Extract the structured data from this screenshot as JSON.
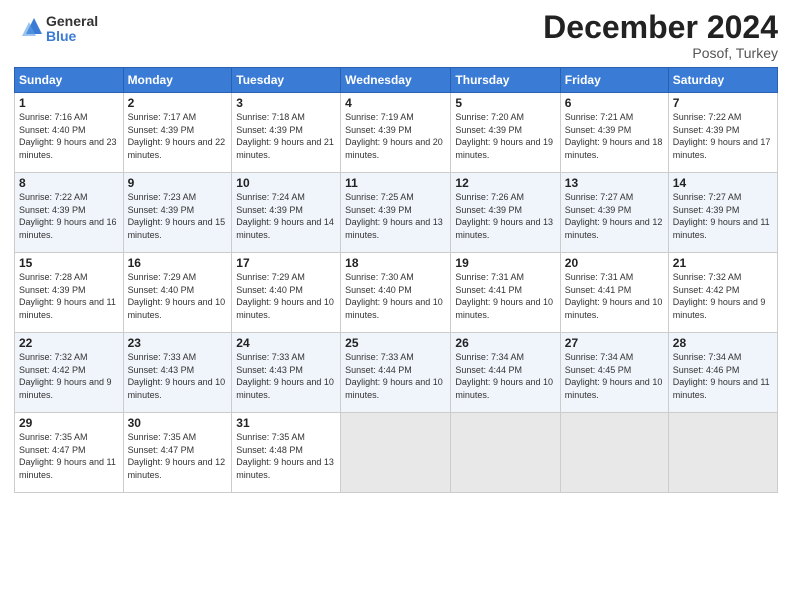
{
  "logo": {
    "general": "General",
    "blue": "Blue"
  },
  "header": {
    "title": "December 2024",
    "subtitle": "Posof, Turkey"
  },
  "columns": [
    "Sunday",
    "Monday",
    "Tuesday",
    "Wednesday",
    "Thursday",
    "Friday",
    "Saturday"
  ],
  "weeks": [
    [
      {
        "day": "1",
        "sunrise": "7:16 AM",
        "sunset": "4:40 PM",
        "daylight": "9 hours and 23 minutes."
      },
      {
        "day": "2",
        "sunrise": "7:17 AM",
        "sunset": "4:39 PM",
        "daylight": "9 hours and 22 minutes."
      },
      {
        "day": "3",
        "sunrise": "7:18 AM",
        "sunset": "4:39 PM",
        "daylight": "9 hours and 21 minutes."
      },
      {
        "day": "4",
        "sunrise": "7:19 AM",
        "sunset": "4:39 PM",
        "daylight": "9 hours and 20 minutes."
      },
      {
        "day": "5",
        "sunrise": "7:20 AM",
        "sunset": "4:39 PM",
        "daylight": "9 hours and 19 minutes."
      },
      {
        "day": "6",
        "sunrise": "7:21 AM",
        "sunset": "4:39 PM",
        "daylight": "9 hours and 18 minutes."
      },
      {
        "day": "7",
        "sunrise": "7:22 AM",
        "sunset": "4:39 PM",
        "daylight": "9 hours and 17 minutes."
      }
    ],
    [
      {
        "day": "8",
        "sunrise": "7:22 AM",
        "sunset": "4:39 PM",
        "daylight": "9 hours and 16 minutes."
      },
      {
        "day": "9",
        "sunrise": "7:23 AM",
        "sunset": "4:39 PM",
        "daylight": "9 hours and 15 minutes."
      },
      {
        "day": "10",
        "sunrise": "7:24 AM",
        "sunset": "4:39 PM",
        "daylight": "9 hours and 14 minutes."
      },
      {
        "day": "11",
        "sunrise": "7:25 AM",
        "sunset": "4:39 PM",
        "daylight": "9 hours and 13 minutes."
      },
      {
        "day": "12",
        "sunrise": "7:26 AM",
        "sunset": "4:39 PM",
        "daylight": "9 hours and 13 minutes."
      },
      {
        "day": "13",
        "sunrise": "7:27 AM",
        "sunset": "4:39 PM",
        "daylight": "9 hours and 12 minutes."
      },
      {
        "day": "14",
        "sunrise": "7:27 AM",
        "sunset": "4:39 PM",
        "daylight": "9 hours and 11 minutes."
      }
    ],
    [
      {
        "day": "15",
        "sunrise": "7:28 AM",
        "sunset": "4:39 PM",
        "daylight": "9 hours and 11 minutes."
      },
      {
        "day": "16",
        "sunrise": "7:29 AM",
        "sunset": "4:40 PM",
        "daylight": "9 hours and 10 minutes."
      },
      {
        "day": "17",
        "sunrise": "7:29 AM",
        "sunset": "4:40 PM",
        "daylight": "9 hours and 10 minutes."
      },
      {
        "day": "18",
        "sunrise": "7:30 AM",
        "sunset": "4:40 PM",
        "daylight": "9 hours and 10 minutes."
      },
      {
        "day": "19",
        "sunrise": "7:31 AM",
        "sunset": "4:41 PM",
        "daylight": "9 hours and 10 minutes."
      },
      {
        "day": "20",
        "sunrise": "7:31 AM",
        "sunset": "4:41 PM",
        "daylight": "9 hours and 10 minutes."
      },
      {
        "day": "21",
        "sunrise": "7:32 AM",
        "sunset": "4:42 PM",
        "daylight": "9 hours and 9 minutes."
      }
    ],
    [
      {
        "day": "22",
        "sunrise": "7:32 AM",
        "sunset": "4:42 PM",
        "daylight": "9 hours and 9 minutes."
      },
      {
        "day": "23",
        "sunrise": "7:33 AM",
        "sunset": "4:43 PM",
        "daylight": "9 hours and 10 minutes."
      },
      {
        "day": "24",
        "sunrise": "7:33 AM",
        "sunset": "4:43 PM",
        "daylight": "9 hours and 10 minutes."
      },
      {
        "day": "25",
        "sunrise": "7:33 AM",
        "sunset": "4:44 PM",
        "daylight": "9 hours and 10 minutes."
      },
      {
        "day": "26",
        "sunrise": "7:34 AM",
        "sunset": "4:44 PM",
        "daylight": "9 hours and 10 minutes."
      },
      {
        "day": "27",
        "sunrise": "7:34 AM",
        "sunset": "4:45 PM",
        "daylight": "9 hours and 10 minutes."
      },
      {
        "day": "28",
        "sunrise": "7:34 AM",
        "sunset": "4:46 PM",
        "daylight": "9 hours and 11 minutes."
      }
    ],
    [
      {
        "day": "29",
        "sunrise": "7:35 AM",
        "sunset": "4:47 PM",
        "daylight": "9 hours and 11 minutes."
      },
      {
        "day": "30",
        "sunrise": "7:35 AM",
        "sunset": "4:47 PM",
        "daylight": "9 hours and 12 minutes."
      },
      {
        "day": "31",
        "sunrise": "7:35 AM",
        "sunset": "4:48 PM",
        "daylight": "9 hours and 13 minutes."
      },
      null,
      null,
      null,
      null
    ]
  ]
}
